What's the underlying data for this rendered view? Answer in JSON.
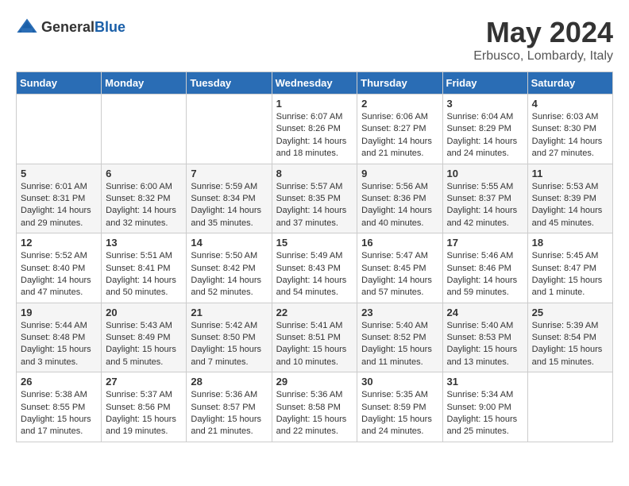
{
  "header": {
    "logo_general": "General",
    "logo_blue": "Blue",
    "month": "May 2024",
    "location": "Erbusco, Lombardy, Italy"
  },
  "weekdays": [
    "Sunday",
    "Monday",
    "Tuesday",
    "Wednesday",
    "Thursday",
    "Friday",
    "Saturday"
  ],
  "weeks": [
    [
      {
        "day": "",
        "info": ""
      },
      {
        "day": "",
        "info": ""
      },
      {
        "day": "",
        "info": ""
      },
      {
        "day": "1",
        "info": "Sunrise: 6:07 AM\nSunset: 8:26 PM\nDaylight: 14 hours and 18 minutes."
      },
      {
        "day": "2",
        "info": "Sunrise: 6:06 AM\nSunset: 8:27 PM\nDaylight: 14 hours and 21 minutes."
      },
      {
        "day": "3",
        "info": "Sunrise: 6:04 AM\nSunset: 8:29 PM\nDaylight: 14 hours and 24 minutes."
      },
      {
        "day": "4",
        "info": "Sunrise: 6:03 AM\nSunset: 8:30 PM\nDaylight: 14 hours and 27 minutes."
      }
    ],
    [
      {
        "day": "5",
        "info": "Sunrise: 6:01 AM\nSunset: 8:31 PM\nDaylight: 14 hours and 29 minutes."
      },
      {
        "day": "6",
        "info": "Sunrise: 6:00 AM\nSunset: 8:32 PM\nDaylight: 14 hours and 32 minutes."
      },
      {
        "day": "7",
        "info": "Sunrise: 5:59 AM\nSunset: 8:34 PM\nDaylight: 14 hours and 35 minutes."
      },
      {
        "day": "8",
        "info": "Sunrise: 5:57 AM\nSunset: 8:35 PM\nDaylight: 14 hours and 37 minutes."
      },
      {
        "day": "9",
        "info": "Sunrise: 5:56 AM\nSunset: 8:36 PM\nDaylight: 14 hours and 40 minutes."
      },
      {
        "day": "10",
        "info": "Sunrise: 5:55 AM\nSunset: 8:37 PM\nDaylight: 14 hours and 42 minutes."
      },
      {
        "day": "11",
        "info": "Sunrise: 5:53 AM\nSunset: 8:39 PM\nDaylight: 14 hours and 45 minutes."
      }
    ],
    [
      {
        "day": "12",
        "info": "Sunrise: 5:52 AM\nSunset: 8:40 PM\nDaylight: 14 hours and 47 minutes."
      },
      {
        "day": "13",
        "info": "Sunrise: 5:51 AM\nSunset: 8:41 PM\nDaylight: 14 hours and 50 minutes."
      },
      {
        "day": "14",
        "info": "Sunrise: 5:50 AM\nSunset: 8:42 PM\nDaylight: 14 hours and 52 minutes."
      },
      {
        "day": "15",
        "info": "Sunrise: 5:49 AM\nSunset: 8:43 PM\nDaylight: 14 hours and 54 minutes."
      },
      {
        "day": "16",
        "info": "Sunrise: 5:47 AM\nSunset: 8:45 PM\nDaylight: 14 hours and 57 minutes."
      },
      {
        "day": "17",
        "info": "Sunrise: 5:46 AM\nSunset: 8:46 PM\nDaylight: 14 hours and 59 minutes."
      },
      {
        "day": "18",
        "info": "Sunrise: 5:45 AM\nSunset: 8:47 PM\nDaylight: 15 hours and 1 minute."
      }
    ],
    [
      {
        "day": "19",
        "info": "Sunrise: 5:44 AM\nSunset: 8:48 PM\nDaylight: 15 hours and 3 minutes."
      },
      {
        "day": "20",
        "info": "Sunrise: 5:43 AM\nSunset: 8:49 PM\nDaylight: 15 hours and 5 minutes."
      },
      {
        "day": "21",
        "info": "Sunrise: 5:42 AM\nSunset: 8:50 PM\nDaylight: 15 hours and 7 minutes."
      },
      {
        "day": "22",
        "info": "Sunrise: 5:41 AM\nSunset: 8:51 PM\nDaylight: 15 hours and 10 minutes."
      },
      {
        "day": "23",
        "info": "Sunrise: 5:40 AM\nSunset: 8:52 PM\nDaylight: 15 hours and 11 minutes."
      },
      {
        "day": "24",
        "info": "Sunrise: 5:40 AM\nSunset: 8:53 PM\nDaylight: 15 hours and 13 minutes."
      },
      {
        "day": "25",
        "info": "Sunrise: 5:39 AM\nSunset: 8:54 PM\nDaylight: 15 hours and 15 minutes."
      }
    ],
    [
      {
        "day": "26",
        "info": "Sunrise: 5:38 AM\nSunset: 8:55 PM\nDaylight: 15 hours and 17 minutes."
      },
      {
        "day": "27",
        "info": "Sunrise: 5:37 AM\nSunset: 8:56 PM\nDaylight: 15 hours and 19 minutes."
      },
      {
        "day": "28",
        "info": "Sunrise: 5:36 AM\nSunset: 8:57 PM\nDaylight: 15 hours and 21 minutes."
      },
      {
        "day": "29",
        "info": "Sunrise: 5:36 AM\nSunset: 8:58 PM\nDaylight: 15 hours and 22 minutes."
      },
      {
        "day": "30",
        "info": "Sunrise: 5:35 AM\nSunset: 8:59 PM\nDaylight: 15 hours and 24 minutes."
      },
      {
        "day": "31",
        "info": "Sunrise: 5:34 AM\nSunset: 9:00 PM\nDaylight: 15 hours and 25 minutes."
      },
      {
        "day": "",
        "info": ""
      }
    ]
  ]
}
